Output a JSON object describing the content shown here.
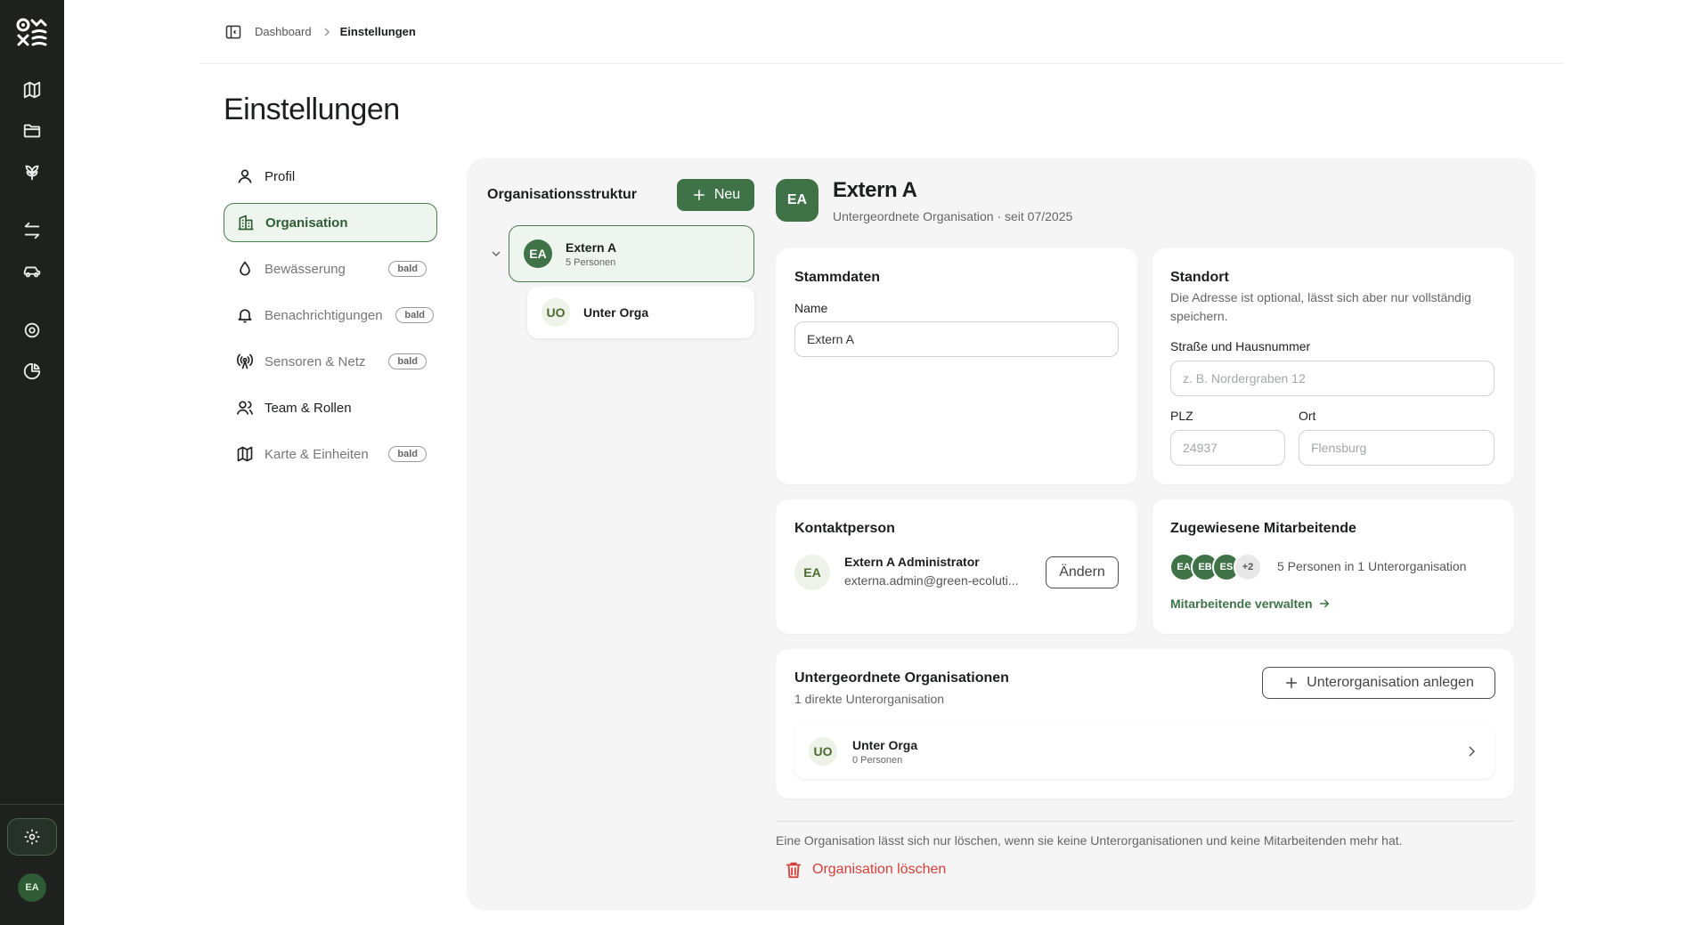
{
  "rail": {
    "avatar": "EA"
  },
  "breadcrumb": {
    "parent": "Dashboard",
    "current": "Einstellungen"
  },
  "page": {
    "title": "Einstellungen"
  },
  "settings_nav": [
    {
      "label": "Profil",
      "icon": "user-icon",
      "badge": null
    },
    {
      "label": "Organisation",
      "icon": "building-icon",
      "badge": null
    },
    {
      "label": "Bewässerung",
      "icon": "droplet-icon",
      "badge": "bald"
    },
    {
      "label": "Benachrichtigungen",
      "icon": "bell-icon",
      "badge": "bald"
    },
    {
      "label": "Sensoren & Netz",
      "icon": "antenna-icon",
      "badge": "bald"
    },
    {
      "label": "Team & Rollen",
      "icon": "users-icon",
      "badge": null
    },
    {
      "label": "Karte & Einheiten",
      "icon": "map-icon",
      "badge": "bald"
    }
  ],
  "tree": {
    "title": "Organisationsstruktur",
    "new_label": "Neu",
    "root": {
      "initials": "EA",
      "name": "Extern A",
      "sub": "5 Personen"
    },
    "child": {
      "initials": "UO",
      "name": "Unter Orga"
    }
  },
  "org": {
    "initials": "EA",
    "name": "Extern A",
    "subtitle": "Untergeordnete Organisation · seit 07/2025"
  },
  "stammdaten": {
    "title": "Stammdaten",
    "name_label": "Name",
    "name_value": "Extern A"
  },
  "standort": {
    "title": "Standort",
    "description": "Die Adresse ist optional, lässt sich aber nur vollständig speichern.",
    "street_label": "Straße und Hausnummer",
    "street_placeholder": "z. B. Nordergraben 12",
    "plz_label": "PLZ",
    "plz_placeholder": "24937",
    "ort_label": "Ort",
    "ort_placeholder": "Flensburg"
  },
  "kontakt": {
    "title": "Kontaktperson",
    "initials": "EA",
    "name": "Extern A Administrator",
    "email": "externa.admin@green-ecoluti...",
    "change_label": "Ändern"
  },
  "mitarbeitende": {
    "title": "Zugewiesene Mitarbeitende",
    "avatars": [
      "EA",
      "EB",
      "ES",
      "+2"
    ],
    "summary": "5 Personen in 1 Unterorganisation",
    "manage_label": "Mitarbeitende verwalten"
  },
  "unterorgs": {
    "title": "Untergeordnete Organisationen",
    "count_text": "1 direkte Unterorganisation",
    "add_label": "Unterorganisation anlegen",
    "items": [
      {
        "initials": "UO",
        "name": "Unter Orga",
        "sub": "0 Personen"
      }
    ]
  },
  "danger": {
    "note": "Eine Organisation lässt sich nur löschen, wenn sie keine Unterorganisationen und keine Mitarbeitenden mehr hat.",
    "delete_label": "Organisation löschen"
  },
  "colors": {
    "brand": "#3f7347",
    "danger": "#d6403b",
    "rail": "#1f211f"
  }
}
